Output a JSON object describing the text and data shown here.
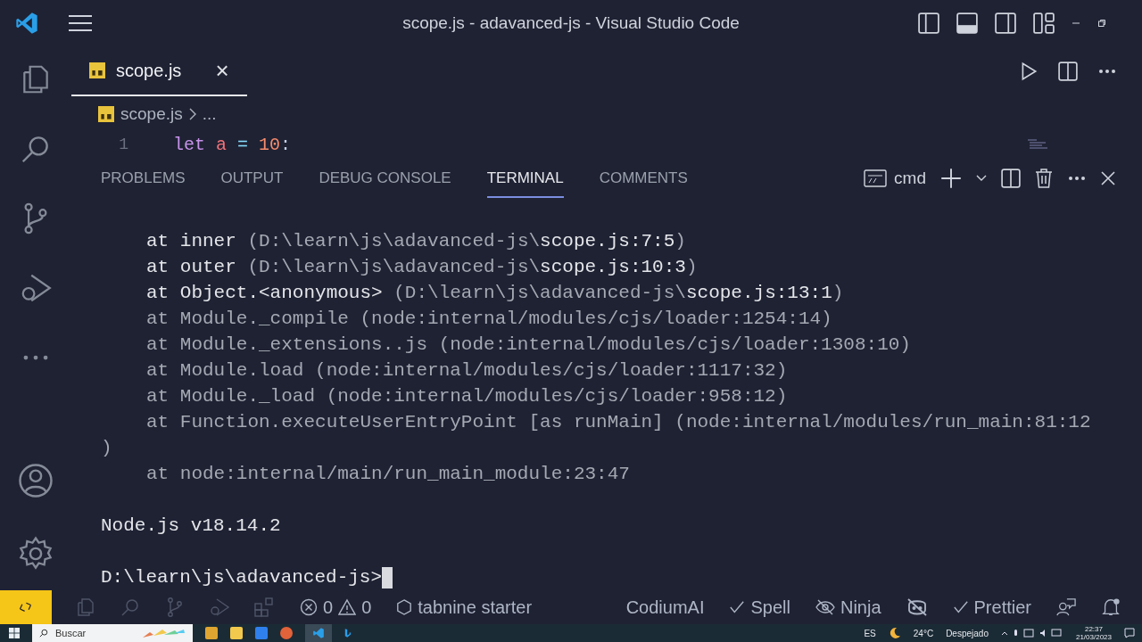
{
  "window": {
    "title": "scope.js - adavanced-js - Visual Studio Code"
  },
  "editor_tabs": [
    {
      "label": "scope.js",
      "selected": true,
      "close": "×"
    }
  ],
  "breadcrumb": {
    "file": "scope.js",
    "more": "..."
  },
  "code": {
    "line_number": "1",
    "tokens": [
      {
        "text": "let",
        "kind": "keyword"
      },
      {
        "text": "a",
        "kind": "variable"
      },
      {
        "text": "=",
        "kind": "operator"
      },
      {
        "text": "10",
        "kind": "number"
      },
      {
        "text": ":",
        "kind": "punct"
      }
    ]
  },
  "panel_tabs": [
    {
      "label": "PROBLEMS",
      "selected": false
    },
    {
      "label": "OUTPUT",
      "selected": false
    },
    {
      "label": "DEBUG CONSOLE",
      "selected": false
    },
    {
      "label": "TERMINAL",
      "selected": true
    },
    {
      "label": "COMMENTS",
      "selected": false
    }
  ],
  "terminal_profile": "cmd",
  "terminal_lines": [
    {
      "indented": true,
      "parts": [
        {
          "text": "at inner",
          "bright": true
        },
        {
          "text": " (D:\\learn\\js\\adavanced-js\\",
          "bright": false
        },
        {
          "text": "scope.js:7:5",
          "bright": true
        },
        {
          "text": ")",
          "bright": false
        }
      ]
    },
    {
      "indented": true,
      "parts": [
        {
          "text": "at outer",
          "bright": true
        },
        {
          "text": " (D:\\learn\\js\\adavanced-js\\",
          "bright": false
        },
        {
          "text": "scope.js:10:3",
          "bright": true
        },
        {
          "text": ")",
          "bright": false
        }
      ]
    },
    {
      "indented": true,
      "parts": [
        {
          "text": "at Object.<anonymous>",
          "bright": true
        },
        {
          "text": " (D:\\learn\\js\\adavanced-js\\",
          "bright": false
        },
        {
          "text": "scope.js:13:1",
          "bright": true
        },
        {
          "text": ")",
          "bright": false
        }
      ]
    },
    {
      "indented": true,
      "parts": [
        {
          "text": "at Module._compile (node:internal/modules/cjs/loader:1254:14)",
          "bright": false
        }
      ]
    },
    {
      "indented": true,
      "parts": [
        {
          "text": "at Module._extensions..js (node:internal/modules/cjs/loader:1308:10)",
          "bright": false
        }
      ]
    },
    {
      "indented": true,
      "parts": [
        {
          "text": "at Module.load (node:internal/modules/cjs/loader:1117:32)",
          "bright": false
        }
      ]
    },
    {
      "indented": true,
      "parts": [
        {
          "text": "at Module._load (node:internal/modules/cjs/loader:958:12)",
          "bright": false
        }
      ]
    },
    {
      "indented": true,
      "parts": [
        {
          "text": "at Function.executeUserEntryPoint [as runMain] (node:internal/modules/run_main:81:12",
          "bright": false
        }
      ]
    },
    {
      "indented": false,
      "parts": [
        {
          "text": ")",
          "bright": false
        }
      ]
    },
    {
      "indented": true,
      "parts": [
        {
          "text": "at node:internal/main/run_main_module:23:47",
          "bright": false
        }
      ]
    }
  ],
  "terminal_footer": [
    {
      "indented": false,
      "parts": [
        {
          "text": "Node.js v18.14.2",
          "bright": true
        }
      ]
    }
  ],
  "prompt": "D:\\learn\\js\\adavanced-js>",
  "status_bar": {
    "errors": "0",
    "warnings": "0",
    "tabnine": "tabnine starter",
    "codium": "CodiumAI",
    "spell": "Spell",
    "ninja": "Ninja",
    "prettier": "Prettier"
  },
  "taskbar": {
    "search_placeholder": "Buscar",
    "language": "ES",
    "weather": "24°C",
    "condition": "Despejado",
    "time": "22:37",
    "date": "21/03/2023"
  }
}
